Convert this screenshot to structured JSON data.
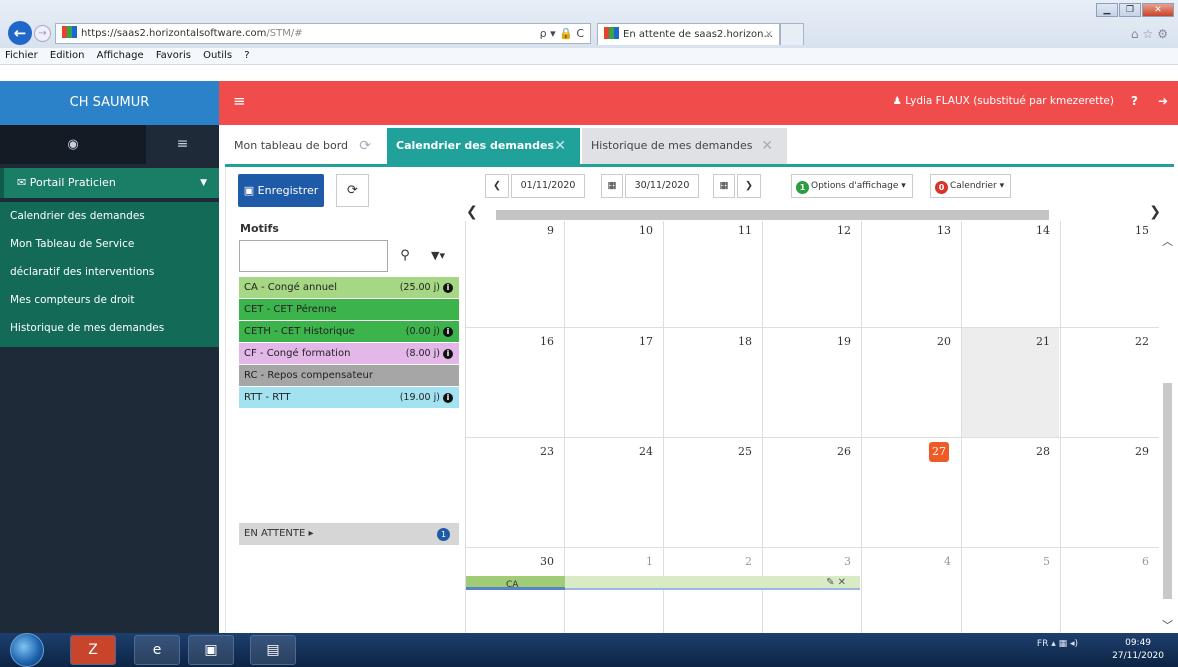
{
  "browser": {
    "url_host": "https://saas2.horizontalsoftware.com",
    "url_path": "/STM/#",
    "addr_tools": "ρ ▾ 🔒 C",
    "tab_title": "En attente de saas2.horizon...",
    "tab_close": "×",
    "menu": [
      "Fichier",
      "Edition",
      "Affichage",
      "Favoris",
      "Outils",
      "?"
    ]
  },
  "app": {
    "brand": "CH SAUMUR",
    "user": "Lydia FLAUX (substitué par kmezerette)",
    "accent_red": "#f04c4c",
    "accent_teal": "#20a19a",
    "accent_blue": "#2c82c9"
  },
  "sidebar": {
    "section": "Portail Praticien",
    "items": [
      {
        "label": "Calendrier des demandes"
      },
      {
        "label": "Mon Tableau de Service"
      },
      {
        "label": "déclaratif des interventions"
      },
      {
        "label": "Mes compteurs de droit"
      },
      {
        "label": "Historique de mes demandes"
      }
    ]
  },
  "tabs": [
    {
      "label": "Mon tableau de bord"
    },
    {
      "label": "Calendrier des demandes"
    },
    {
      "label": "Historique de mes demandes"
    }
  ],
  "toolbar": {
    "save_label": "Enregistrer",
    "date_from": "01/11/2020",
    "date_to": "30/11/2020",
    "options_label": "Options d'affichage",
    "options_count": "1",
    "calendar_label": "Calendrier",
    "calendar_count": "0"
  },
  "motifs": {
    "title": "Motifs",
    "search_value": "",
    "items": [
      {
        "label": "CA - Congé annuel",
        "balance": "(25.00 j)",
        "color": "#a6d784"
      },
      {
        "label": "CET - CET Pérenne",
        "balance": "",
        "color": "#3cb44b"
      },
      {
        "label": "CETH - CET Historique",
        "balance": "(0.00 j)",
        "color": "#3cb44b"
      },
      {
        "label": "CF - Congé formation",
        "balance": "(8.00 j)",
        "color": "#e3b8e8"
      },
      {
        "label": "RC - Repos compensateur",
        "balance": "",
        "color": "#a6a6a6"
      },
      {
        "label": "RTT - RTT",
        "balance": "(19.00 j)",
        "color": "#a3e3f1"
      }
    ],
    "pending_label": "EN ATTENTE ▸",
    "pending_count": "1"
  },
  "calendar": {
    "weeks": [
      [
        "9",
        "10",
        "11",
        "12",
        "13",
        "14",
        "15"
      ],
      [
        "16",
        "17",
        "18",
        "19",
        "20",
        "21",
        "22"
      ],
      [
        "23",
        "24",
        "25",
        "26",
        "27",
        "28",
        "29"
      ],
      [
        "30",
        "1",
        "2",
        "3",
        "4",
        "5",
        "6"
      ]
    ],
    "today": "27",
    "event_label": "CA",
    "event_actions": "✎ ✕"
  },
  "taskbar": {
    "lang": "FR",
    "time": "09:49",
    "date": "27/11/2020"
  }
}
